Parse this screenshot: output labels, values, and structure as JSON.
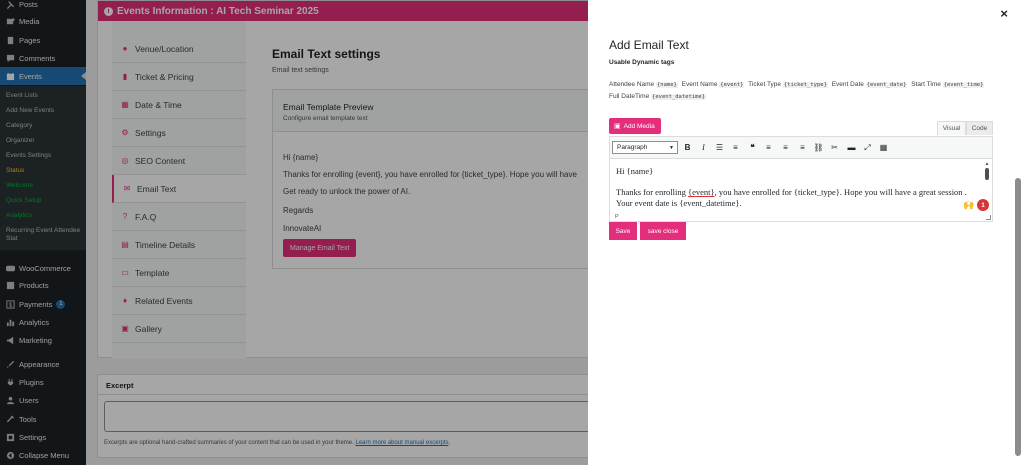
{
  "sidebar": {
    "items": [
      {
        "label": "Posts",
        "icon": "pin-icon"
      },
      {
        "label": "Media",
        "icon": "media-icon"
      },
      {
        "label": "Pages",
        "icon": "pages-icon"
      },
      {
        "label": "Comments",
        "icon": "comments-icon"
      },
      {
        "label": "Events",
        "icon": "calendar-icon"
      }
    ],
    "submenu": [
      "Event Lists",
      "Add New Events",
      "Category",
      "Organizer",
      "Events Settings",
      "Status",
      "Welcome",
      "Quick Setup",
      "Analytics",
      "Recurring Event Attendee Stat"
    ],
    "items2": [
      {
        "label": "WooCommerce",
        "icon": "woocommerce-icon"
      },
      {
        "label": "Products",
        "icon": "products-icon"
      },
      {
        "label": "Payments",
        "icon": "payments-icon",
        "badge": "1"
      },
      {
        "label": "Analytics",
        "icon": "analytics-icon"
      },
      {
        "label": "Marketing",
        "icon": "marketing-icon"
      },
      {
        "label": "Appearance",
        "icon": "appearance-icon"
      },
      {
        "label": "Plugins",
        "icon": "plugins-icon"
      },
      {
        "label": "Users",
        "icon": "users-icon"
      },
      {
        "label": "Tools",
        "icon": "tools-icon"
      },
      {
        "label": "Settings",
        "icon": "settings-icon"
      },
      {
        "label": "Collapse Menu",
        "icon": "collapse-icon"
      }
    ]
  },
  "events": {
    "header": "Events Information : AI Tech Seminar 2025",
    "tabs": [
      "Venue/Location",
      "Ticket & Pricing",
      "Date & Time",
      "Settings",
      "SEO Content",
      "Email Text",
      "F.A.Q",
      "Timeline Details",
      "Template",
      "Related Events",
      "Gallery"
    ],
    "email_title": "Email Text settings",
    "email_sub": "Email text settings",
    "preview_title": "Email Template Preview",
    "preview_sub": "Configure email template text",
    "preview_lines": [
      "Hi {name}",
      "Thanks for enrolling {event}, you have enrolled for {ticket_type}. Hope you will have",
      "Get ready to unlock the power of AI.",
      "Regards",
      "InnovateAI"
    ],
    "manage_btn": "Manage Email Text"
  },
  "excerpt": {
    "title": "Excerpt",
    "help": "Excerpts are optional hand-crafted summaries of your content that can be used in your theme.",
    "link": "Learn more about manual excerpts"
  },
  "panel": {
    "close": "×",
    "title": "Add Email Text",
    "sub": "Usable Dynamic tags",
    "tags": [
      {
        "label": "Attendee Name",
        "code": "{name}"
      },
      {
        "label": "Event Name",
        "code": "{event}"
      },
      {
        "label": "Ticket Type",
        "code": "{ticket_type}"
      },
      {
        "label": "Event Date",
        "code": "{event_date}"
      },
      {
        "label": "Start Time",
        "code": "{event_time}"
      },
      {
        "label": "Full DateTime",
        "code": "{event_datetime}"
      }
    ],
    "add_media": "Add Media",
    "visual_tab": "Visual",
    "code_tab": "Code",
    "format": "Paragraph",
    "content_line1": "Hi {name}",
    "content_pre": "Thanks for enrolling ",
    "content_event": "{event}",
    "content_post": ", you have enrolled for {ticket_type}. Hope you will have a great session . Your event date is {event_datetime}.",
    "path": "P",
    "notif_count": "1",
    "save": "Save",
    "save_close": "save close"
  },
  "colors": {
    "accent": "#e32e7c",
    "wp_blue": "#2271b1",
    "sidebar": "#1d2327"
  }
}
